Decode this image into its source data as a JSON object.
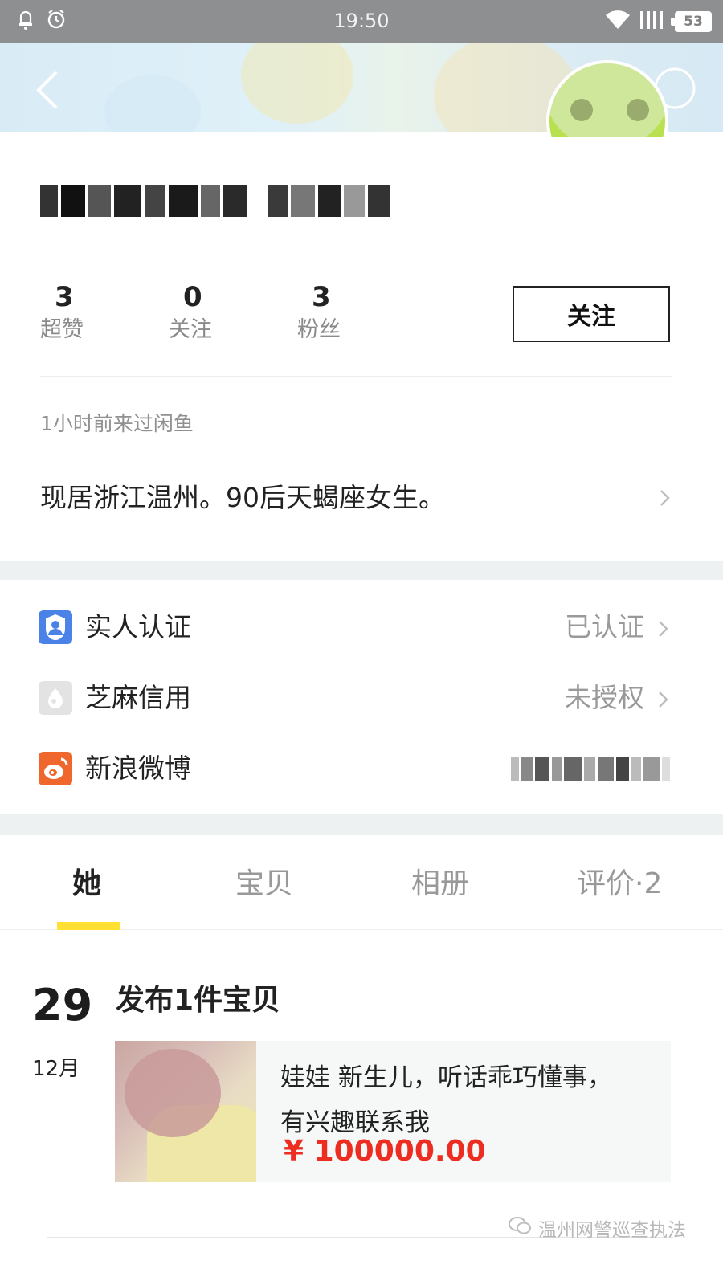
{
  "status_bar": {
    "time": "19:50",
    "battery": "53"
  },
  "profile": {
    "stats": [
      {
        "value": "3",
        "label": "超赞"
      },
      {
        "value": "0",
        "label": "关注"
      },
      {
        "value": "3",
        "label": "粉丝"
      }
    ],
    "follow_button": "关注",
    "last_seen": "1小时前来过闲鱼",
    "bio": "现居浙江温州。90后天蝎座女生。"
  },
  "verification": [
    {
      "label": "实人认证",
      "value": "已认证",
      "icon": "person-id-icon",
      "color": "#4a82e8"
    },
    {
      "label": "芝麻信用",
      "value": "未授权",
      "icon": "sesame-credit-icon",
      "color": "#cfcfcf"
    },
    {
      "label": "新浪微博",
      "value": "",
      "icon": "weibo-icon",
      "color": "#f0672d"
    }
  ],
  "tabs": [
    "她",
    "宝贝",
    "相册",
    "评价·2"
  ],
  "feed": {
    "day": "29",
    "month": "12月",
    "title": "发布1件宝贝",
    "item": {
      "line1": "娃娃 新生儿，听话乖巧懂事，",
      "line2": "有兴趣联系我",
      "price": "¥ 100000.00"
    }
  },
  "watermark": "温州网警巡查执法",
  "colors": {
    "accent_yellow": "#ffe033",
    "price_red": "#ee2d22",
    "status_bar": "#8e8f90"
  }
}
